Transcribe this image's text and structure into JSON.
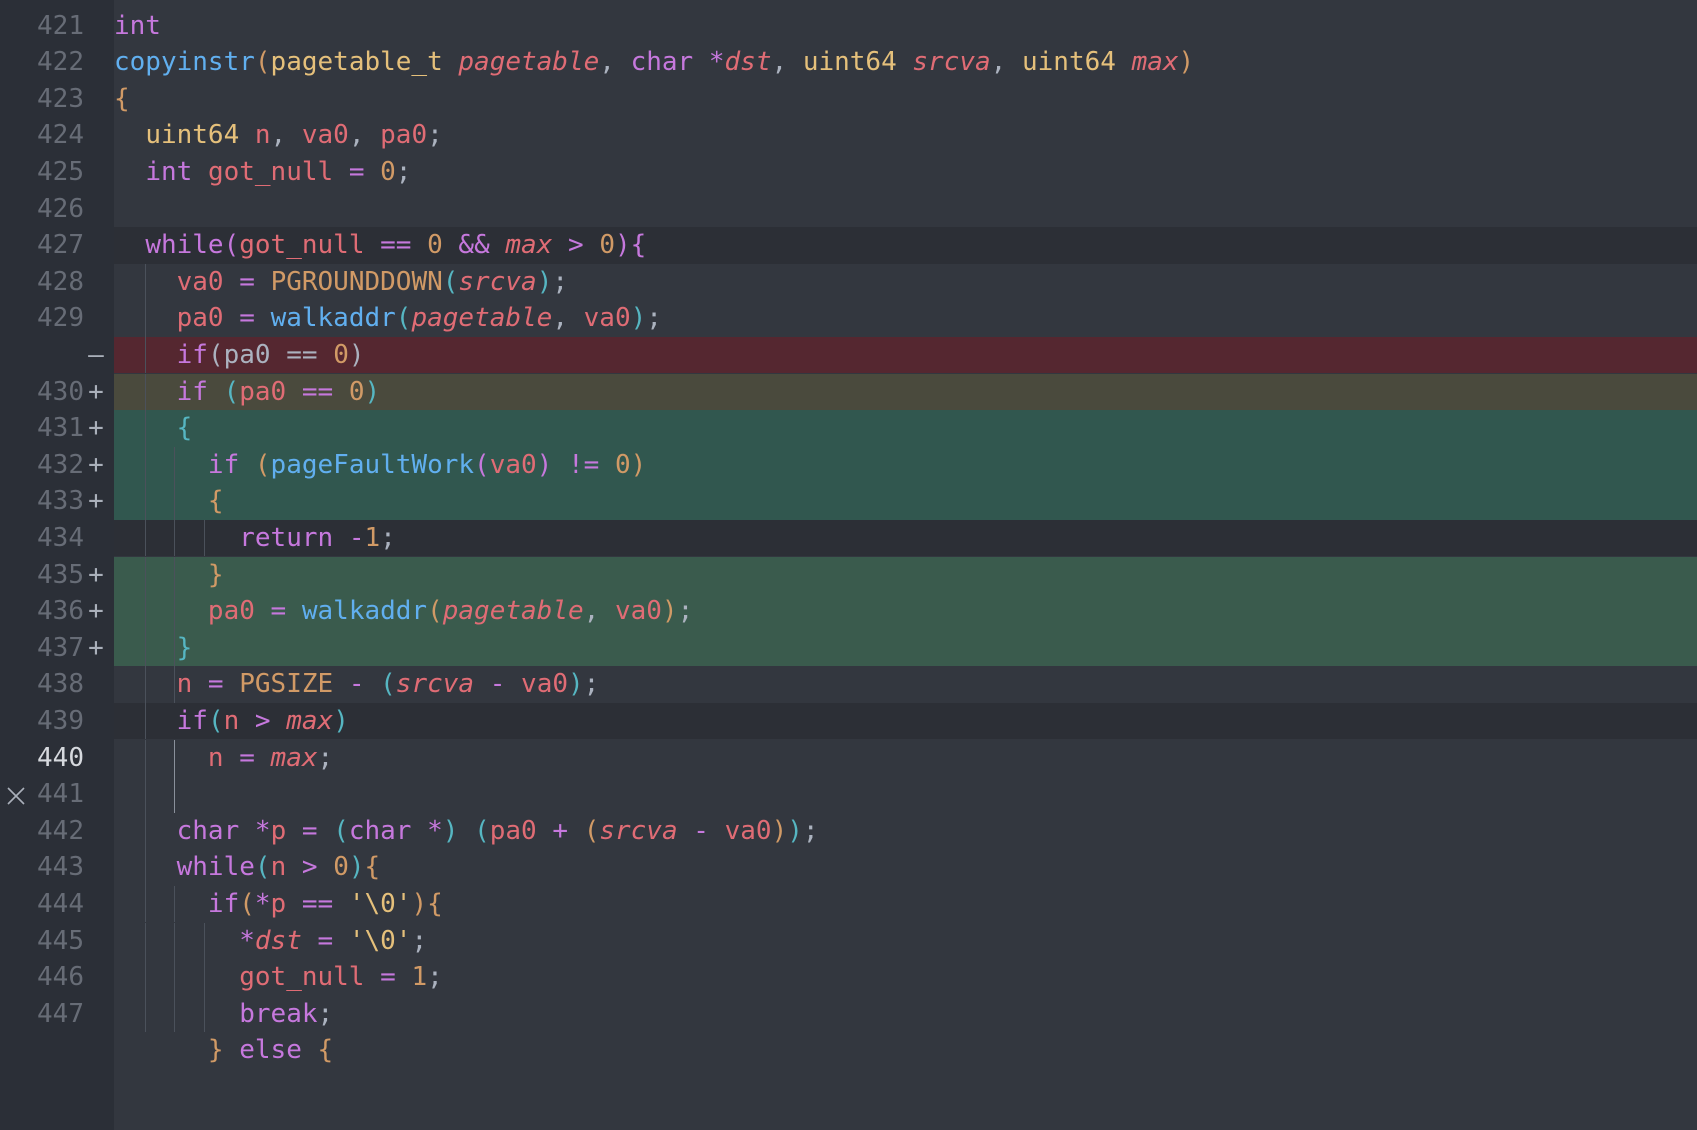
{
  "editor": {
    "colors": {
      "background": "#33373f",
      "gutter": "#2b2f37",
      "current_line": "#2c2f36",
      "removed_line": "#552730",
      "added_line": "#3a5b4d",
      "added_line_alt": "#31574f",
      "modified_line": "#4a4a3d"
    },
    "icons": {
      "conflict_marker": "x-mark-icon"
    },
    "lines": [
      {
        "num": "421",
        "marker": "",
        "code": [
          [
            "int",
            "kw"
          ]
        ]
      },
      {
        "num": "422",
        "marker": "",
        "code": [
          [
            "copyinstr",
            "fn"
          ],
          [
            "(",
            "br1"
          ],
          [
            "pagetable_t ",
            "type"
          ],
          [
            "pagetable",
            "par"
          ],
          [
            ", ",
            "pun"
          ],
          [
            "char ",
            "kw"
          ],
          [
            "*",
            "op"
          ],
          [
            "dst",
            "par"
          ],
          [
            ", ",
            "pun"
          ],
          [
            "uint64 ",
            "type"
          ],
          [
            "srcva",
            "par"
          ],
          [
            ", ",
            "pun"
          ],
          [
            "uint64 ",
            "type"
          ],
          [
            "max",
            "par"
          ],
          [
            ")",
            "br1"
          ]
        ]
      },
      {
        "num": "423",
        "marker": "",
        "code": [
          [
            "{",
            "br1"
          ]
        ]
      },
      {
        "num": "424",
        "marker": "",
        "code": [
          [
            "  ",
            "pun"
          ],
          [
            "uint64 ",
            "type"
          ],
          [
            "n",
            "var"
          ],
          [
            ", ",
            "pun"
          ],
          [
            "va0",
            "var"
          ],
          [
            ", ",
            "pun"
          ],
          [
            "pa0",
            "var"
          ],
          [
            ";",
            "pun"
          ]
        ]
      },
      {
        "num": "425",
        "marker": "",
        "code": [
          [
            "  ",
            "pun"
          ],
          [
            "int ",
            "kw"
          ],
          [
            "got_null",
            "var"
          ],
          [
            " = ",
            "op"
          ],
          [
            "0",
            "num"
          ],
          [
            ";",
            "pun"
          ]
        ]
      },
      {
        "num": "426",
        "marker": "",
        "code": []
      },
      {
        "num": "427",
        "marker": "",
        "code": [
          [
            "  ",
            "pun"
          ],
          [
            "while",
            "kw"
          ],
          [
            "(",
            "br2"
          ],
          [
            "got_null",
            "var"
          ],
          [
            " == ",
            "op"
          ],
          [
            "0",
            "num"
          ],
          [
            " && ",
            "op"
          ],
          [
            "max",
            "par"
          ],
          [
            " > ",
            "op"
          ],
          [
            "0",
            "num"
          ],
          [
            ")",
            "br2"
          ],
          [
            "{",
            "br2"
          ]
        ]
      },
      {
        "num": "428",
        "marker": "",
        "code": [
          [
            "    ",
            "pun"
          ],
          [
            "va0",
            "var"
          ],
          [
            " = ",
            "op"
          ],
          [
            "PGROUNDDOWN",
            "mac"
          ],
          [
            "(",
            "br3"
          ],
          [
            "srcva",
            "par"
          ],
          [
            ")",
            "br3"
          ],
          [
            ";",
            "pun"
          ]
        ]
      },
      {
        "num": "429",
        "marker": "",
        "code": [
          [
            "    ",
            "pun"
          ],
          [
            "pa0",
            "var"
          ],
          [
            " = ",
            "op"
          ],
          [
            "walkaddr",
            "fn"
          ],
          [
            "(",
            "br3"
          ],
          [
            "pagetable",
            "par"
          ],
          [
            ", ",
            "pun"
          ],
          [
            "va0",
            "var"
          ],
          [
            ")",
            "br3"
          ],
          [
            ";",
            "pun"
          ]
        ]
      },
      {
        "num": "",
        "marker": "—",
        "code": [
          [
            "    ",
            "pun"
          ],
          [
            "if",
            "kw"
          ],
          [
            "(",
            "pun"
          ],
          [
            "pa0",
            "pun"
          ],
          [
            " == ",
            "pun"
          ],
          [
            "0",
            "num"
          ],
          [
            ")",
            "pun"
          ]
        ]
      },
      {
        "num": "430",
        "marker": "+",
        "code": [
          [
            "    ",
            "pun"
          ],
          [
            "if",
            "kw"
          ],
          [
            " ",
            "pun"
          ],
          [
            "(",
            "br3"
          ],
          [
            "pa0",
            "var"
          ],
          [
            " == ",
            "op"
          ],
          [
            "0",
            "num"
          ],
          [
            ")",
            "br3"
          ]
        ]
      },
      {
        "num": "431",
        "marker": "+",
        "code": [
          [
            "    ",
            "pun"
          ],
          [
            "{",
            "br3"
          ]
        ]
      },
      {
        "num": "432",
        "marker": "+",
        "code": [
          [
            "      ",
            "pun"
          ],
          [
            "if",
            "kw"
          ],
          [
            " ",
            "pun"
          ],
          [
            "(",
            "br1"
          ],
          [
            "pageFaultWork",
            "fn"
          ],
          [
            "(",
            "br2"
          ],
          [
            "va0",
            "var"
          ],
          [
            ")",
            "br2"
          ],
          [
            " != ",
            "op"
          ],
          [
            "0",
            "num"
          ],
          [
            ")",
            "br1"
          ]
        ]
      },
      {
        "num": "433",
        "marker": "+",
        "code": [
          [
            "      ",
            "pun"
          ],
          [
            "{",
            "br1"
          ]
        ]
      },
      {
        "num": "434",
        "marker": "",
        "code": [
          [
            "        ",
            "pun"
          ],
          [
            "return",
            "kw"
          ],
          [
            " ",
            "pun"
          ],
          [
            "-",
            "op"
          ],
          [
            "1",
            "num"
          ],
          [
            ";",
            "pun"
          ]
        ]
      },
      {
        "num": "435",
        "marker": "+",
        "code": [
          [
            "      ",
            "pun"
          ],
          [
            "}",
            "br1"
          ]
        ]
      },
      {
        "num": "436",
        "marker": "+",
        "code": [
          [
            "      ",
            "pun"
          ],
          [
            "pa0",
            "var"
          ],
          [
            " = ",
            "op"
          ],
          [
            "walkaddr",
            "fn"
          ],
          [
            "(",
            "br1"
          ],
          [
            "pagetable",
            "par"
          ],
          [
            ", ",
            "pun"
          ],
          [
            "va0",
            "var"
          ],
          [
            ")",
            "br1"
          ],
          [
            ";",
            "pun"
          ]
        ]
      },
      {
        "num": "437",
        "marker": "+",
        "code": [
          [
            "    ",
            "pun"
          ],
          [
            "}",
            "br3"
          ]
        ]
      },
      {
        "num": "438",
        "marker": "",
        "code": [
          [
            "    ",
            "pun"
          ],
          [
            "n",
            "var"
          ],
          [
            " = ",
            "op"
          ],
          [
            "PGSIZE",
            "mac"
          ],
          [
            " - ",
            "op"
          ],
          [
            "(",
            "br3"
          ],
          [
            "srcva",
            "par"
          ],
          [
            " - ",
            "op"
          ],
          [
            "va0",
            "var"
          ],
          [
            ")",
            "br3"
          ],
          [
            ";",
            "pun"
          ]
        ]
      },
      {
        "num": "439",
        "marker": "",
        "code": [
          [
            "    ",
            "pun"
          ],
          [
            "if",
            "kw"
          ],
          [
            "(",
            "br3"
          ],
          [
            "n",
            "var"
          ],
          [
            " > ",
            "op"
          ],
          [
            "max",
            "par"
          ],
          [
            ")",
            "br3"
          ]
        ]
      },
      {
        "num": "440",
        "marker": "",
        "code": [
          [
            "      ",
            "pun"
          ],
          [
            "n",
            "var"
          ],
          [
            " = ",
            "op"
          ],
          [
            "max",
            "par"
          ],
          [
            ";",
            "pun"
          ]
        ]
      },
      {
        "num": "441",
        "marker": "",
        "code": []
      },
      {
        "num": "442",
        "marker": "",
        "code": [
          [
            "    ",
            "pun"
          ],
          [
            "char ",
            "kw"
          ],
          [
            "*",
            "op"
          ],
          [
            "p",
            "var"
          ],
          [
            " = ",
            "op"
          ],
          [
            "(",
            "br3"
          ],
          [
            "char ",
            "kw"
          ],
          [
            "*",
            "op"
          ],
          [
            ")",
            "br3"
          ],
          [
            " ",
            "pun"
          ],
          [
            "(",
            "br3"
          ],
          [
            "pa0",
            "var"
          ],
          [
            " + ",
            "op"
          ],
          [
            "(",
            "br1"
          ],
          [
            "srcva",
            "par"
          ],
          [
            " - ",
            "op"
          ],
          [
            "va0",
            "var"
          ],
          [
            ")",
            "br1"
          ],
          [
            ")",
            "br3"
          ],
          [
            ";",
            "pun"
          ]
        ]
      },
      {
        "num": "443",
        "marker": "",
        "code": [
          [
            "    ",
            "pun"
          ],
          [
            "while",
            "kw"
          ],
          [
            "(",
            "br3"
          ],
          [
            "n",
            "var"
          ],
          [
            " > ",
            "op"
          ],
          [
            "0",
            "num"
          ],
          [
            ")",
            "br3"
          ],
          [
            "{",
            "br1"
          ]
        ]
      },
      {
        "num": "444",
        "marker": "",
        "code": [
          [
            "      ",
            "pun"
          ],
          [
            "if",
            "kw"
          ],
          [
            "(",
            "br1"
          ],
          [
            "*",
            "op"
          ],
          [
            "p",
            "var"
          ],
          [
            " == ",
            "op"
          ],
          [
            "'\\0'",
            "str2"
          ],
          [
            ")",
            "br1"
          ],
          [
            "{",
            "br1"
          ]
        ]
      },
      {
        "num": "445",
        "marker": "",
        "code": [
          [
            "        ",
            "pun"
          ],
          [
            "*",
            "op"
          ],
          [
            "dst",
            "par"
          ],
          [
            " = ",
            "op"
          ],
          [
            "'\\0'",
            "str2"
          ],
          [
            ";",
            "pun"
          ]
        ]
      },
      {
        "num": "446",
        "marker": "",
        "code": [
          [
            "        ",
            "pun"
          ],
          [
            "got_null",
            "var"
          ],
          [
            " = ",
            "op"
          ],
          [
            "1",
            "num"
          ],
          [
            ";",
            "pun"
          ]
        ]
      },
      {
        "num": "447",
        "marker": "",
        "code": [
          [
            "        ",
            "pun"
          ],
          [
            "break",
            "kw"
          ],
          [
            ";",
            "pun"
          ]
        ]
      },
      {
        "num": "",
        "marker": "",
        "code": [
          [
            "      ",
            "pun"
          ],
          [
            "}",
            "br1"
          ],
          [
            " else ",
            "kw"
          ],
          [
            "{",
            "br1"
          ]
        ]
      }
    ]
  }
}
